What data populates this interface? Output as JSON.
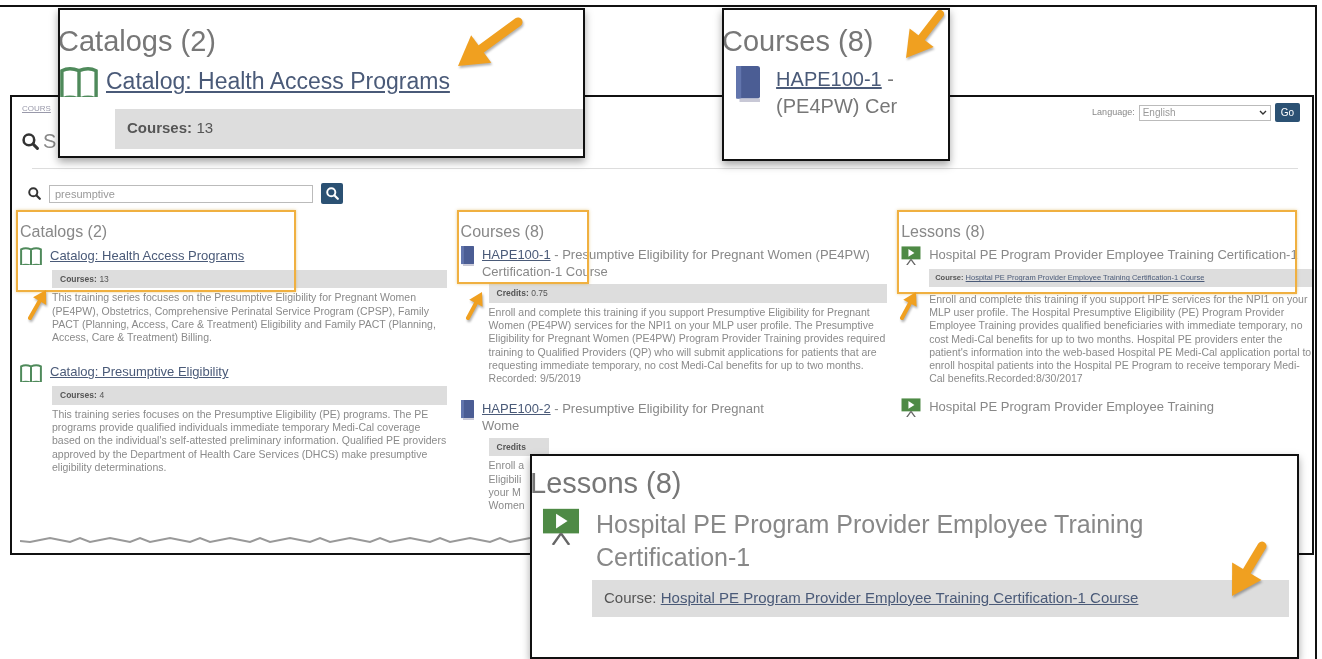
{
  "page": {
    "breadcrumb": "COURS",
    "search_heading": "S",
    "language": {
      "label": "Language:",
      "value": "English",
      "button": "Go"
    },
    "search": {
      "value": "presumptive"
    },
    "catalogs": {
      "heading": "Catalogs (2)",
      "highlighted": true,
      "items": [
        {
          "title": "Catalog: Health Access Programs",
          "meta_label": "Courses:",
          "meta_value": "13",
          "description": "This training series focuses on the Presumptive Eligibility for Pregnant Women (PE4PW), Obstetrics, Comprehensive Perinatal Service Program (CPSP), Family PACT (Planning, Access, Care & Treatment) Eligibility and Family PACT (Planning, Access, Care & Treatment) Billing."
        },
        {
          "title": "Catalog: Presumptive Eligibility",
          "meta_label": "Courses:",
          "meta_value": "4",
          "description": "This training series focuses on the Presumptive Eligibility (PE) programs. The PE programs provide qualified individuals immediate temporary Medi-Cal coverage based on the individual's self-attested preliminary information. Qualified PE providers approved by the Department of Health Care Services (DHCS) make presumptive eligibility determinations."
        }
      ]
    },
    "courses": {
      "heading": "Courses (8)",
      "highlighted": true,
      "items": [
        {
          "code": "HAPE100-1",
          "title_lines": [
            " - Presumptive Eligibility for Pregnant Women (PE4PW) Certification-1 Course"
          ],
          "meta_label": "Credits:",
          "meta_value": "0.75",
          "description_lines": [
            "Enroll and complete this training if you support Presumptive Eligibility for Pregnant Women (PE4PW) services for the NPI1 on your MLP user profile. The Presumptive Eligibility for Pregnant Women (PE4PW) Program Provider Training provides required training to Qualified Providers (QP) who will submit applications for patients that are requesting immediate temporary, no cost Medi-Cal benefits for up to two months. Recorded: 9/5/2019"
          ]
        },
        {
          "code": "HAPE100-2",
          "title_lines": [
            " - Presumptive Eligibility for Pregnant",
            "Wome"
          ],
          "meta_label": "Credits",
          "description_lines": [
            "Enroll a",
            "Eligibili",
            "your M",
            "Women"
          ]
        }
      ]
    },
    "lessons": {
      "heading": "Lessons (8)",
      "highlighted": true,
      "items": [
        {
          "title": "Hospital PE Program Provider Employee Training Certification-1",
          "course_label": "Course:",
          "course_link": "Hospital PE Program Provider Employee Training Certification-1 Course",
          "description": "Enroll and complete this training if you support HPE services for the NPI1 on your MLP user profile. The Hospital Presumptive Eligibility (PE) Program Provider Employee Training provides qualified beneficiaries with immediate temporary, no cost Medi-Cal benefits for up to two months. Hospital PE providers enter the patient's information into the web-based Hospital PE Medi-Cal application portal to enroll hospital patients into the Hospital PE Program to receive temporary Medi-Cal benefits.Recorded:8/30/2017"
        },
        {
          "title": "Hospital PE Program Provider Employee Training"
        }
      ]
    }
  },
  "callouts": [
    {
      "kind": "catalog",
      "heading": "Catalogs (2)",
      "link": "Catalog: Health Access Programs",
      "meta_label": "Courses:",
      "meta_value": "13"
    },
    {
      "kind": "course",
      "heading": "Courses (8)",
      "code": "HAPE100-1",
      "title_lines": [
        " -",
        "(PE4PW) Cer"
      ]
    },
    {
      "kind": "lesson",
      "heading": "Lessons (8)",
      "title": "Hospital PE Program Provider Employee Training Certification-1",
      "course_label": "Course:",
      "course_link": "Hospital PE Program Provider Employee Training Certification-1 Course"
    }
  ]
}
